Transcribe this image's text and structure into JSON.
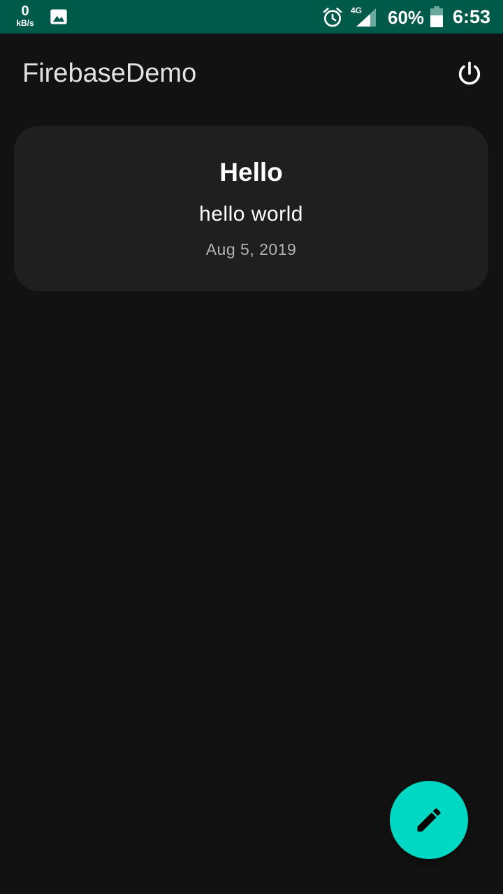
{
  "status_bar": {
    "net_speed_value": "0",
    "net_speed_unit": "kB/s",
    "network_type": "4G",
    "battery_percent": "60%",
    "time": "6:53",
    "icons": [
      "image-icon",
      "alarm-icon",
      "signal-icon",
      "battery-icon"
    ]
  },
  "app_bar": {
    "title": "FirebaseDemo",
    "action_icon": "power-icon"
  },
  "notes": [
    {
      "title": "Hello",
      "body": "hello world",
      "date": "Aug 5, 2019"
    }
  ],
  "fab": {
    "icon": "pencil-icon"
  },
  "colors": {
    "status_bar": "#005a4a",
    "background": "#121212",
    "card": "#1f1f1f",
    "accent": "#00d8c4"
  }
}
